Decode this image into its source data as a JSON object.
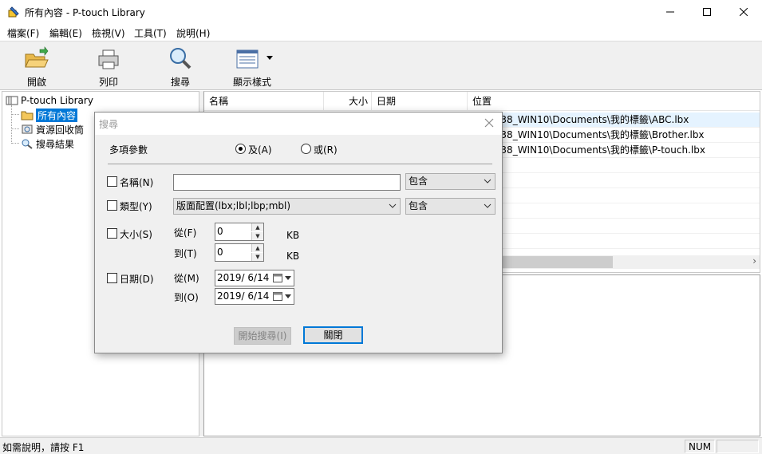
{
  "window": {
    "title": "所有內容 - P-touch Library"
  },
  "menu": [
    "檔案(F)",
    "編輯(E)",
    "檢視(V)",
    "工具(T)",
    "說明(H)"
  ],
  "toolbar": {
    "open": "開啟",
    "print": "列印",
    "search": "搜尋",
    "view_style": "顯示樣式"
  },
  "tree": {
    "root": "P-touch Library",
    "all": "所有內容",
    "recycle": "資源回收筒",
    "results": "搜尋結果"
  },
  "list": {
    "headers": [
      "名稱",
      "大小",
      "日期",
      "位置"
    ],
    "rows": [
      {
        "location": "rs\\VM138_WIN10\\Documents\\我的標籤\\ABC.lbx"
      },
      {
        "location": "rs\\VM138_WIN10\\Documents\\我的標籤\\Brother.lbx"
      },
      {
        "location": "rs\\VM138_WIN10\\Documents\\我的標籤\\P-touch.lbx"
      }
    ]
  },
  "status": {
    "help": "如需說明，請按 F1",
    "num": "NUM"
  },
  "dialog": {
    "title": "搜尋",
    "multi_param": "多項參數",
    "and": "及(A)",
    "or": "或(R)",
    "name": "名稱(N)",
    "name_value": "",
    "name_condition": "包含",
    "type": "類型(Y)",
    "type_value": "版面配置(lbx;lbl;lbp;mbl)",
    "type_condition": "包含",
    "size": "大小(S)",
    "from_f": "從(F)",
    "to_t": "到(T)",
    "size_from": "0",
    "size_to": "0",
    "kb": "KB",
    "date": "日期(D)",
    "from_m": "從(M)",
    "to_o": "到(O)",
    "date_from": "2019/  6/14",
    "date_to": "2019/  6/14",
    "start_search": "開始搜尋(I)",
    "close": "關閉"
  }
}
